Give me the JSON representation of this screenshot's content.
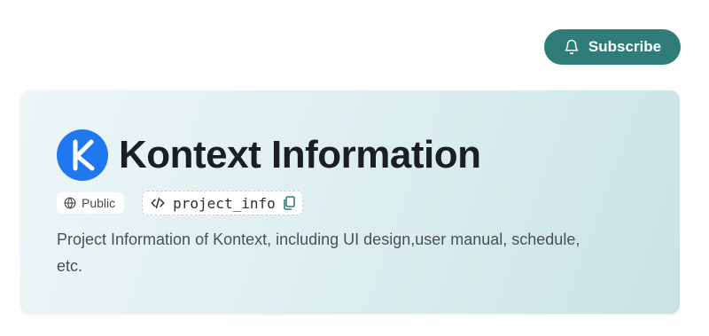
{
  "header": {
    "subscribe_label": "Subscribe",
    "subscribe_icon": "bell-icon",
    "subscribe_color": "#2f7d79"
  },
  "project": {
    "logo_letter": "K",
    "logo_color": "#1f78f0",
    "title": "Kontext Information",
    "visibility": "Public",
    "visibility_icon": "globe-icon",
    "code_name": "project_info",
    "code_icon": "code-icon",
    "copy_icon": "copy-icon",
    "description": "Project Information of Kontext, including UI design,user manual, schedule, etc."
  }
}
